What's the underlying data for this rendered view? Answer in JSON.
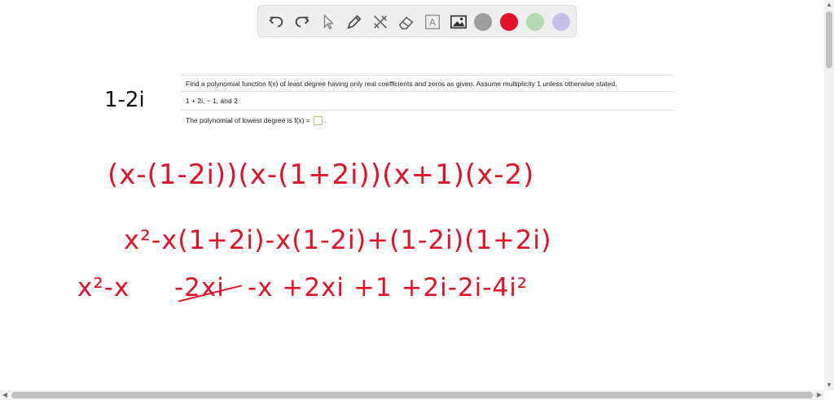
{
  "toolbar": {
    "tools": [
      "undo-icon",
      "redo-icon",
      "pointer-icon",
      "pen-icon",
      "tools-icon",
      "eraser-icon",
      "text-icon",
      "image-icon"
    ],
    "text_tool_glyph": "A",
    "swatches": [
      {
        "name": "gray",
        "color": "#9e9e9e"
      },
      {
        "name": "red",
        "color": "#e5112a"
      },
      {
        "name": "green",
        "color": "#b4d9b0"
      },
      {
        "name": "purple",
        "color": "#c4c0e8"
      }
    ]
  },
  "question": {
    "prompt": "Find a polynomial function f(x) of least degree having only real coefficients and zeros as given. Assume multiplicity 1 unless otherwise stated.",
    "zeros": "1 + 2i, − 1, and 2",
    "answer_label": "The polynomial of lowest degree is f(x) =",
    "answer_suffix": "."
  },
  "handwriting": {
    "side_note": "1-2i",
    "line1": "(x-(1-2i))(x-(1+2i))(x+1)(x-2)",
    "line2": "x²-x(1+2i)-x(1-2i)+(1-2i)(1+2i)",
    "line3_a": "x²-x",
    "line3_struck": "-2xi",
    "line3_b": "-x +2xi +1 +2i-2i-4i²"
  },
  "colors": {
    "ink": "#e5112a",
    "toolbar_bg": "#efefef"
  }
}
